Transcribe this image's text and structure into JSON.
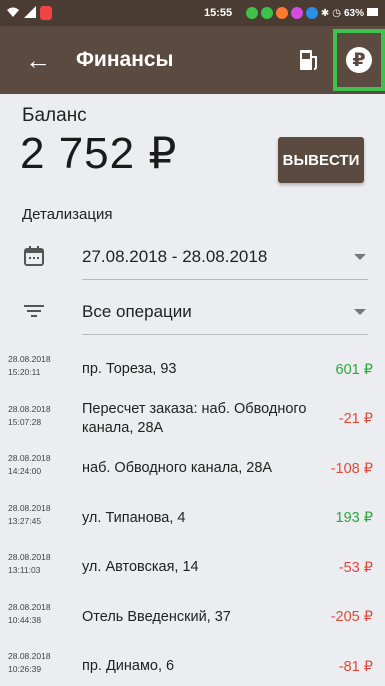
{
  "status_bar": {
    "time": "15:55",
    "battery": "63%"
  },
  "app_bar": {
    "title": "Финансы",
    "rub_symbol": "₽"
  },
  "balance": {
    "label": "Баланс",
    "value": "2 752 ₽",
    "withdraw_label": "ВЫВЕСТИ"
  },
  "details": {
    "label": "Детализация",
    "date_range": "27.08.2018 - 28.08.2018",
    "operations_filter": "Все операции"
  },
  "transactions": [
    {
      "date": "28.08.2018",
      "time": "15:20:11",
      "address": "пр. Тореза, 93",
      "amount": "601 ₽",
      "type": "pos"
    },
    {
      "date": "28.08.2018",
      "time": "15:07:28",
      "address": "Пересчет заказа: наб. Обводного канала, 28А",
      "amount": "-21 ₽",
      "type": "neg"
    },
    {
      "date": "28.08.2018",
      "time": "14:24:00",
      "address": "наб. Обводного канала, 28А",
      "amount": "-108 ₽",
      "type": "neg"
    },
    {
      "date": "28.08.2018",
      "time": "13:27:45",
      "address": "ул. Типанова, 4",
      "amount": "193 ₽",
      "type": "pos"
    },
    {
      "date": "28.08.2018",
      "time": "13:11:03",
      "address": "ул. Автовская, 14",
      "amount": "-53 ₽",
      "type": "neg"
    },
    {
      "date": "28.08.2018",
      "time": "10:44:38",
      "address": "Отель Введенский, 37",
      "amount": "-205 ₽",
      "type": "neg"
    },
    {
      "date": "28.08.2018",
      "time": "10:26:39",
      "address": "пр. Динамо, 6",
      "amount": "-81 ₽",
      "type": "neg"
    }
  ],
  "colors": {
    "primary": "#5b4a40",
    "highlight": "#3fc24b",
    "positive": "#2aa838",
    "negative": "#e04a3b"
  }
}
